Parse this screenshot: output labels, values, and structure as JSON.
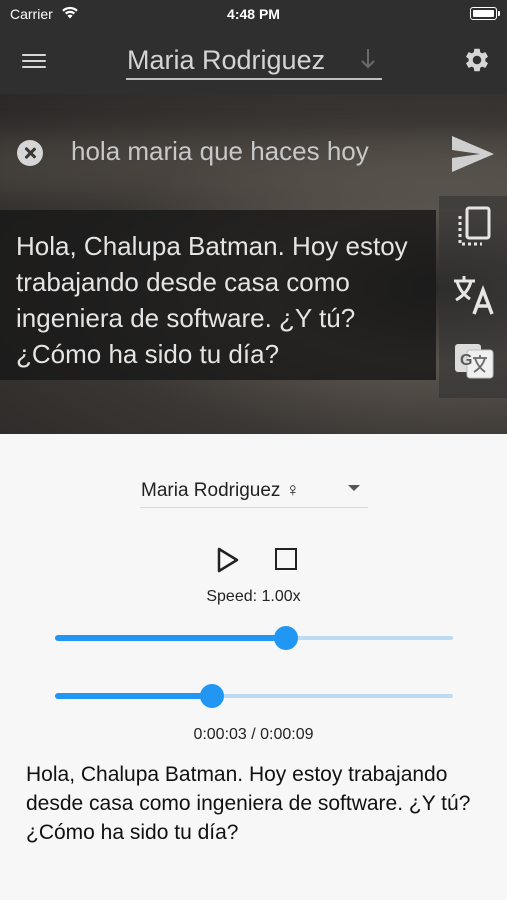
{
  "status_bar": {
    "carrier": "Carrier",
    "time": "4:48 PM"
  },
  "app_bar": {
    "title": "Maria Rodriguez"
  },
  "chat": {
    "input_text": "hola maria que haces hoy",
    "reply_text": "Hola, Chalupa Batman. Hoy estoy trabajando desde casa como ingeniera de software. ¿Y tú? ¿Cómo ha sido tu día?"
  },
  "side_tools": {
    "icons": [
      "copy-icon",
      "translate-icon",
      "google-translate-icon"
    ]
  },
  "player": {
    "voice": "Maria Rodriguez ♀",
    "speed_label": "Speed: 1.00x",
    "speed_value_fraction": 0.58,
    "progress_value_fraction": 0.395,
    "time_label": "0:00:03 / 0:00:09",
    "accent_color": "#2196f3",
    "track_color": "#bcdcf6"
  },
  "transcript": "Hola, Chalupa Batman. Hoy estoy trabajando desde casa como ingeniera de software. ¿Y tú? ¿Cómo ha sido tu día?"
}
